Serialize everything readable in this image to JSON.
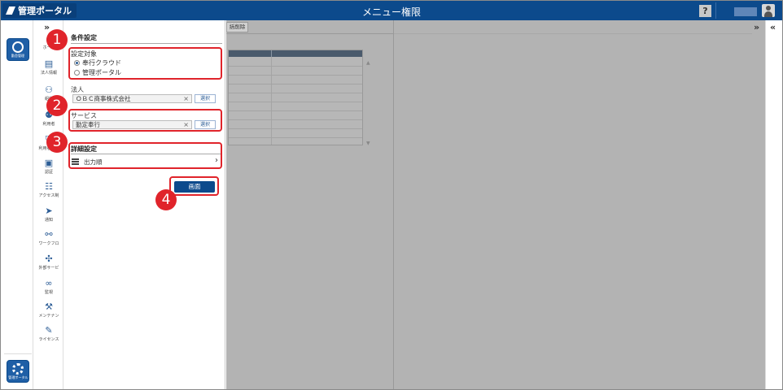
{
  "header": {
    "logo_text": "管理ポータル",
    "title": "メニュー権限",
    "help_label": "?"
  },
  "app_rail": {
    "apps": [
      {
        "label": "勤怠管理"
      },
      {
        "label": "管理ポータル"
      }
    ]
  },
  "menu_rail": {
    "toggle": "»",
    "items": [
      {
        "label": "ホーム",
        "icon": "home-icon"
      },
      {
        "label": "法人情報",
        "icon": "building-icon"
      },
      {
        "label": "組織",
        "icon": "org-chart-icon"
      },
      {
        "label": "利用者",
        "icon": "users-icon"
      },
      {
        "label": "利用者権限",
        "icon": "shield-user-icon"
      },
      {
        "label": "認証",
        "icon": "id-card-icon"
      },
      {
        "label": "アクセス制",
        "icon": "access-control-icon"
      },
      {
        "label": "通知",
        "icon": "paper-plane-icon"
      },
      {
        "label": "ワークフロ",
        "icon": "workflow-icon"
      },
      {
        "label": "外部サービ",
        "icon": "puzzle-icon"
      },
      {
        "label": "監視",
        "icon": "binoculars-icon"
      },
      {
        "label": "メンテナン",
        "icon": "hammer-icon"
      },
      {
        "label": "ライセンス",
        "icon": "license-icon"
      }
    ]
  },
  "conditions": {
    "heading": "条件設定",
    "target": {
      "label": "設定対象",
      "options": [
        {
          "label": "奉行クラウド",
          "selected": true
        },
        {
          "label": "管理ポータル",
          "selected": false
        }
      ]
    },
    "corporation": {
      "label": "法人",
      "value": "ＯＢＣ商事株式会社",
      "clear": "×",
      "select_label": "選択"
    },
    "service": {
      "label": "サービス",
      "value": "勤定奉行",
      "clear": "×",
      "select_label": "選択"
    },
    "details": {
      "heading": "詳細設定",
      "output_order_label": "出力順",
      "chevron": "›"
    },
    "display_button": "画面"
  },
  "content": {
    "bulk_delete_label": "括削除",
    "grid_rows": 10,
    "expand_toggle": "»",
    "collapse_toggle": "«"
  },
  "callouts": [
    "1",
    "2",
    "3",
    "4"
  ],
  "colors": {
    "header_bg": "#0c4a8c",
    "annotation_red": "#e0242b",
    "overlay_gray": "#b3b3b3"
  }
}
